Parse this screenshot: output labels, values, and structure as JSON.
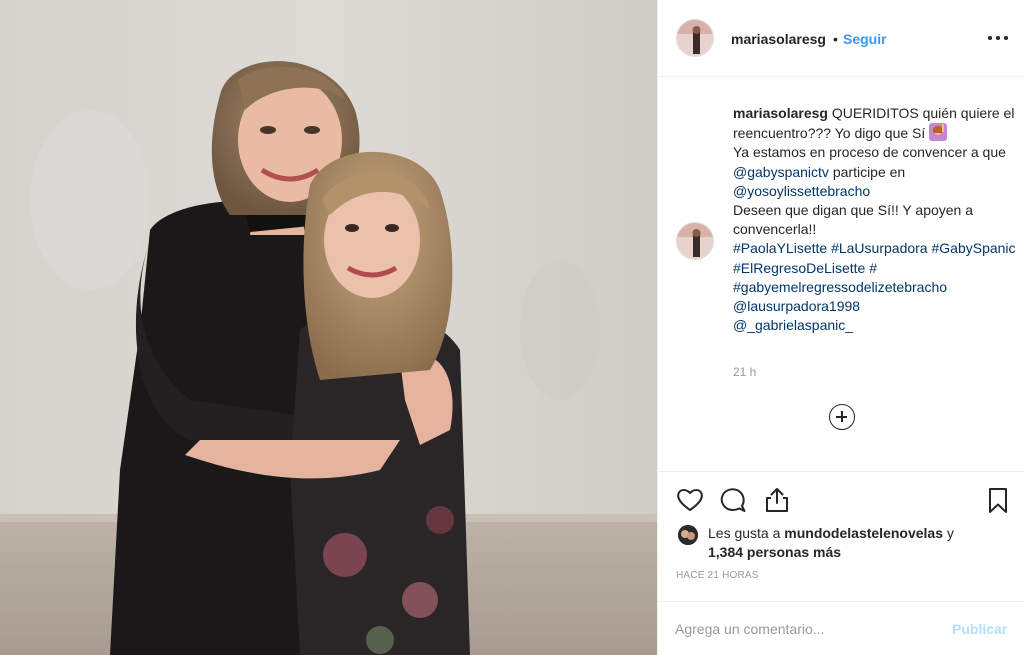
{
  "post": {
    "username": "mariasolaresg",
    "dot": "•",
    "follow_label": "Seguir",
    "more_icon": "ellipsis-icon"
  },
  "caption": {
    "username": "mariasolaresg",
    "line1": "QUERIDITOS quién quiere el reencuentro??? Yo digo que Sí",
    "emoji": "woman-raising-hand-emoji",
    "line2_pre": "Ya estamos en proceso de convencer a que",
    "mention1": "@gabyspanictv",
    "line2_mid": "participe en",
    "mention2": "@yosoylissettebracho",
    "line3": "Deseen que digan que Sí!! Y apoyen a convencerla!!",
    "tags": [
      "#PaolaYLisette",
      "#LaUsurpadora",
      "#GabySpanic",
      "#ElRegresoDeLisette",
      "#",
      "#gabyemelregressodelizetebracho"
    ],
    "mention3": "@lausurpadora1998",
    "mention4": "@_gabrielaspanic_",
    "time": "21 h"
  },
  "actions": {
    "like_icon": "heart-icon",
    "comment_icon": "comment-icon",
    "share_icon": "share-icon",
    "save_icon": "bookmark-icon"
  },
  "likes": {
    "prefix": "Les gusta a",
    "liker": "mundodelastelenovelas",
    "suffix": "y",
    "others": "1,384 personas más"
  },
  "ago": "HACE 21 HORAS",
  "comment": {
    "placeholder": "Agrega un comentario...",
    "publish_label": "Publicar"
  },
  "colors": {
    "link": "#3897f0",
    "hashtag": "#00376b",
    "muted": "#999999",
    "publish_disabled": "#b2dffc"
  }
}
